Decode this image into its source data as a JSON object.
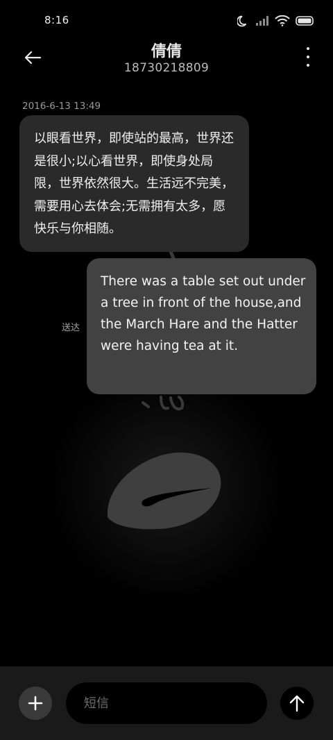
{
  "status_bar": {
    "time": "8:16",
    "icons": [
      "moon-icon",
      "signal-icon",
      "wifi-icon",
      "battery-icon"
    ]
  },
  "header": {
    "contact_name": "倩倩",
    "phone_number": "18730218809",
    "icons": [
      "back-arrow-icon",
      "more-vertical-icon"
    ]
  },
  "conversation": {
    "timestamp": "2016-6-13 13:49",
    "messages": [
      {
        "direction": "incoming",
        "text": "以眼看世界，即使站的最高，世界还是很小;以心看世界，即使身处局限，世界依然很大。生活远不完美，需要用心去体会;无需拥有太多，愿快乐与你相随。"
      },
      {
        "direction": "outgoing",
        "text": "There was a table set out under a tree in front of the house,and the March Hare and the Hatter were having tea at it.",
        "status": "送达"
      }
    ]
  },
  "composer": {
    "placeholder": "短信",
    "icons": [
      "plus-icon",
      "send-arrow-icon"
    ]
  },
  "colors": {
    "background": "#000000",
    "incoming_bubble": "#2a2a2a",
    "outgoing_bubble": "#424242",
    "composer_bar": "#1a1a1a"
  }
}
